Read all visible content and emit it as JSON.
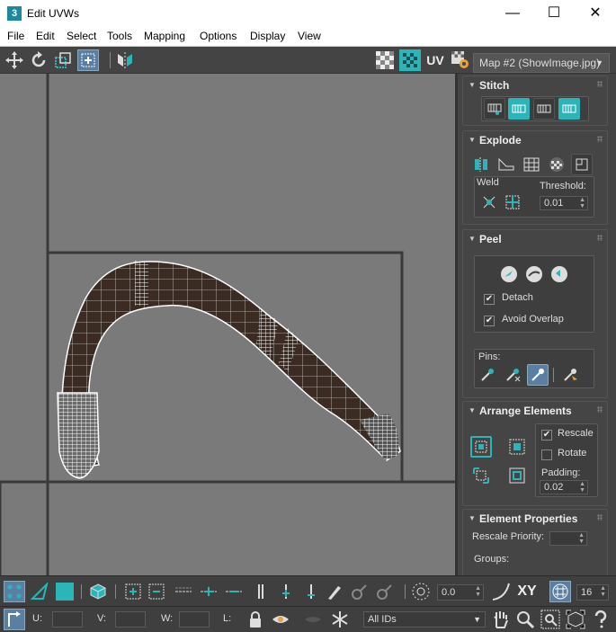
{
  "window": {
    "app_badge": "3",
    "title": "Edit UVWs",
    "minimize": "—",
    "maximize": "☐",
    "close": "✕"
  },
  "menu": [
    "File",
    "Edit",
    "Select",
    "Tools",
    "Mapping",
    "Options",
    "Display",
    "View"
  ],
  "toolbar": {
    "uv_label": "UV",
    "map_selector": "Map #2 (ShowImage.jpg)"
  },
  "panels": {
    "stitch": {
      "title": "Stitch"
    },
    "explode": {
      "title": "Explode",
      "weld_label": "Weld",
      "threshold_label": "Threshold:",
      "threshold_value": "0.01"
    },
    "peel": {
      "title": "Peel",
      "detach_label": "Detach",
      "detach_checked": "✔",
      "avoid_overlap_label": "Avoid Overlap",
      "avoid_overlap_checked": "✔",
      "pins_label": "Pins:"
    },
    "arrange": {
      "title": "Arrange Elements",
      "rescale_label": "Rescale",
      "rescale_checked": "✔",
      "rotate_label": "Rotate",
      "padding_label": "Padding:",
      "padding_value": "0.02"
    },
    "element_props": {
      "title": "Element Properties",
      "rescale_priority_label": "Rescale Priority:",
      "groups_label": "Groups:"
    }
  },
  "bottom": {
    "angle_value": "0.0",
    "xy_label": "XY",
    "grid_value": "16",
    "u_label": "U:",
    "v_label": "V:",
    "w_label": "W:",
    "l_label": "L:",
    "ids_selector": "All IDs"
  },
  "colors": {
    "accent": "#2bb5b8",
    "viewport_bg": "#7a7a7a",
    "panel_bg": "#444444",
    "mesh_fill": "#3b2b22"
  }
}
